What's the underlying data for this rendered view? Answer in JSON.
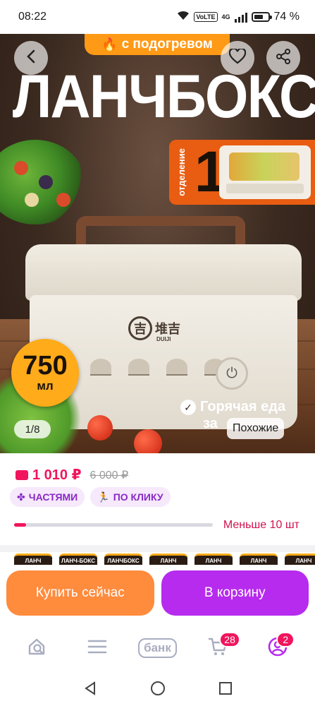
{
  "status_bar": {
    "time": "08:22",
    "network": "4G",
    "volte": "VoLTE",
    "battery": "74 %"
  },
  "hero": {
    "promo_label": "с подогревом",
    "product_title": "ЛАНЧБОКС",
    "compartment_label": "отделение",
    "compartment_number": "1",
    "brand_logo": "堆吉",
    "brand_sub": "DUIJI",
    "volume_value": "750",
    "volume_unit": "мл",
    "image_pager": "1/8",
    "hot_food_line1": "Горячая еда",
    "hot_food_line2": "за",
    "similar_button": "Похожие"
  },
  "pricing": {
    "price": "1 010 ₽",
    "old_price": "6 000 ₽"
  },
  "chips": [
    {
      "label": "ЧАСТЯМИ",
      "icon": "puzzle-icon"
    },
    {
      "label": "ПО КЛИКУ",
      "icon": "running-icon"
    }
  ],
  "stock": {
    "label": "Меньше 10 шт",
    "fill_fraction": 0.06
  },
  "thumbnail_labels": [
    "ЛАНЧ",
    "ЛАНЧ-БОКС",
    "ЛАНЧБОКС",
    "ЛАНЧ",
    "ЛАНЧ",
    "ЛАНЧ",
    "ЛАНЧ"
  ],
  "actions": {
    "buy_now": "Купить сейчас",
    "add_to_cart": "В корзину"
  },
  "tabbar": {
    "bank_label": "банк",
    "cart_badge": "28",
    "profile_badge": "2"
  },
  "colors": {
    "accent": "#f0155d",
    "buy": "#ff8b3d",
    "cart": "#b62bee",
    "chip_bg": "#f5e9fb",
    "chip_text": "#8a28c7"
  }
}
